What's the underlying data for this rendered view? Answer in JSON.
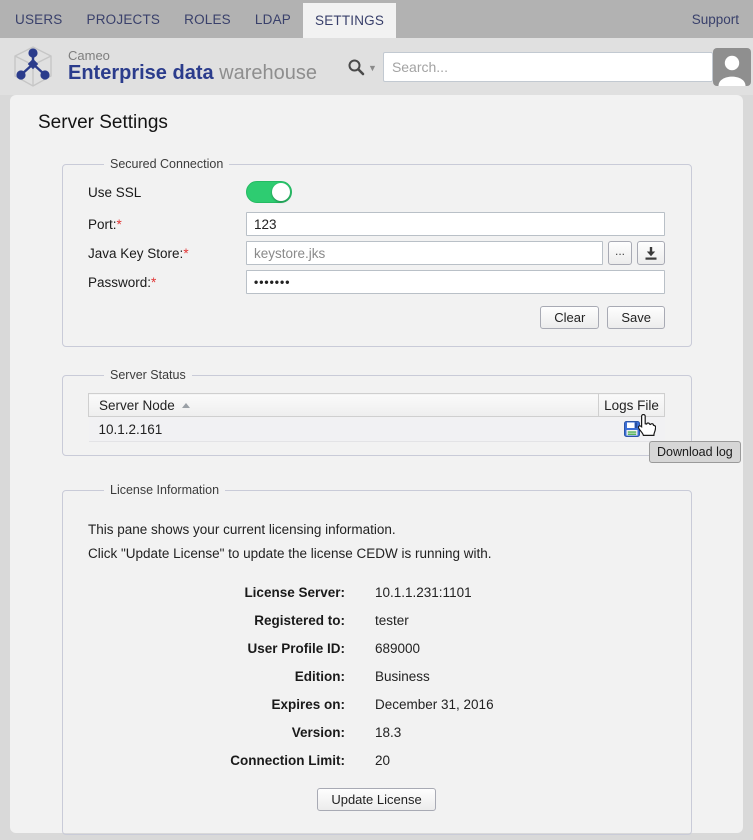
{
  "nav": {
    "items": [
      {
        "label": "USERS"
      },
      {
        "label": "PROJECTS"
      },
      {
        "label": "ROLES"
      },
      {
        "label": "LDAP"
      },
      {
        "label": "SETTINGS"
      }
    ],
    "active_item": "SETTINGS",
    "support_label": "Support"
  },
  "header": {
    "brand_top": "Cameo",
    "brand_bold": "Enterprise data",
    "brand_light": "warehouse",
    "search_placeholder": "Search..."
  },
  "page": {
    "title": "Server Settings"
  },
  "secured_connection": {
    "legend": "Secured Connection",
    "ssl_label": "Use SSL",
    "ssl_state": "on",
    "port_label": "Port:",
    "port_required": "*",
    "port_value": "123",
    "keystore_label": "Java Key Store:",
    "keystore_required": "*",
    "keystore_value": "keystore.jks",
    "browse_label": "...",
    "password_label": "Password:",
    "password_required": "*",
    "password_value": "•••••••",
    "clear_label": "Clear",
    "save_label": "Save"
  },
  "server_status": {
    "legend": "Server Status",
    "columns": {
      "node": "Server Node",
      "logs": "Logs File"
    },
    "sort": "ascending",
    "rows": [
      {
        "node": "10.1.2.161"
      }
    ],
    "tooltip": "Download log"
  },
  "license": {
    "legend": "License Information",
    "line1": "This pane shows your current licensing information.",
    "line2": "Click \"Update License\" to update the license CEDW is running with.",
    "entries": [
      {
        "label": "License Server:",
        "value": "10.1.1.231:1101"
      },
      {
        "label": "Registered to:",
        "value": "tester"
      },
      {
        "label": "User Profile ID:",
        "value": "689000"
      },
      {
        "label": "Edition:",
        "value": "Business"
      },
      {
        "label": "Expires on:",
        "value": "December 31, 2016"
      },
      {
        "label": "Version:",
        "value": "18.3"
      },
      {
        "label": "Connection Limit:",
        "value": "20"
      }
    ],
    "update_label": "Update License"
  },
  "colors": {
    "nav_bg": "#b2b2b2",
    "nav_text": "#39406b",
    "brand_blue": "#2b3c8c",
    "toggle_on_green": "#2ecc71",
    "required_red": "#e03535",
    "card_bg": "#f2f2f2",
    "page_bg": "#d9d9d9"
  }
}
